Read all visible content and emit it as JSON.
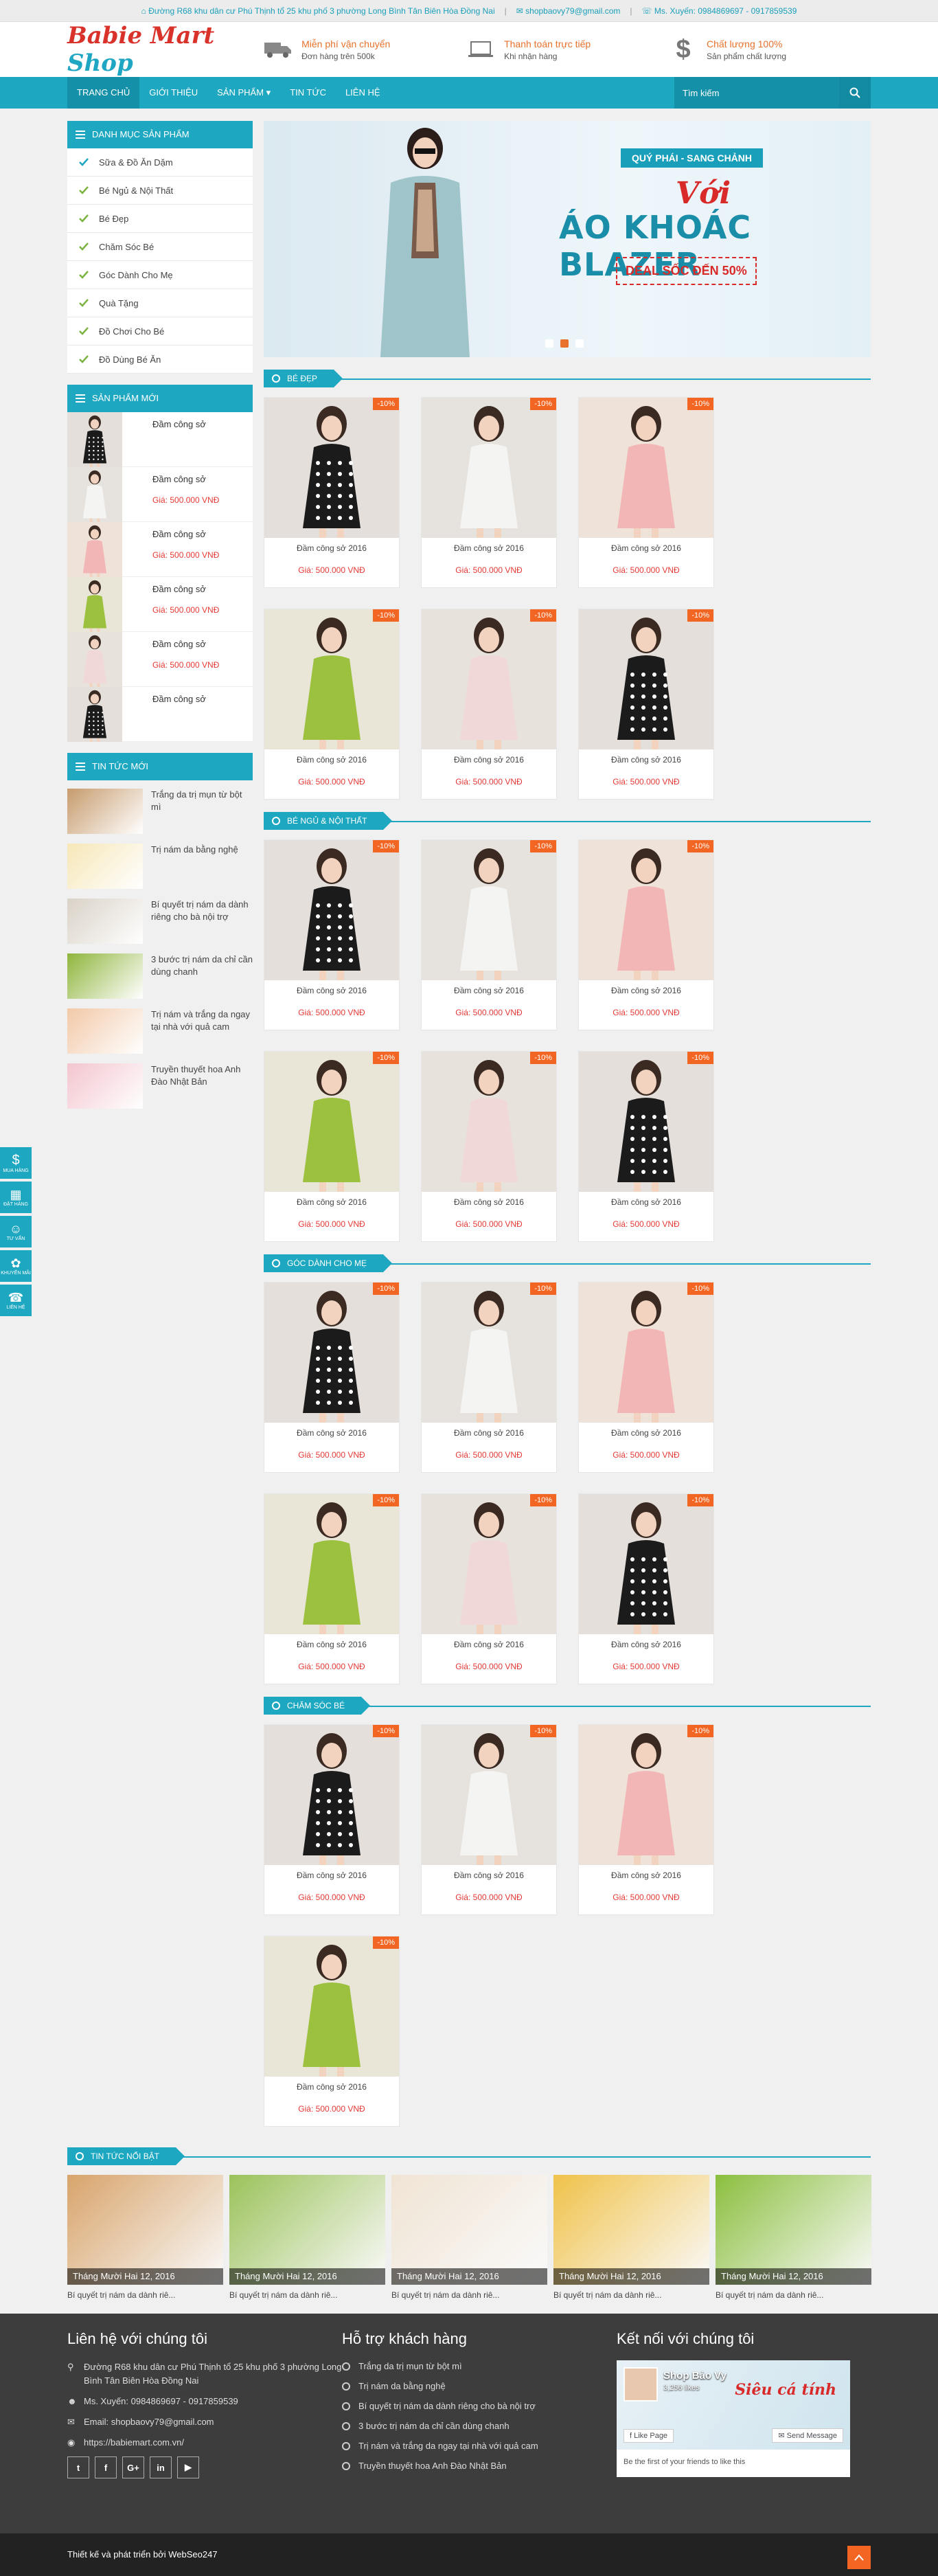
{
  "topbar": {
    "address": "Đường R68 khu dân cư Phú Thịnh tổ 25 khu phố 3 phường Long Bình Tân Biên Hòa Đồng Nai",
    "email": "shopbaovy79@gmail.com",
    "phone": "Ms. Xuyến: 0984869697 - 0917859539"
  },
  "logo": {
    "part1": "Babie Mart",
    "part2": "Shop"
  },
  "features": [
    {
      "title": "Miễn phí vận chuyển",
      "sub": "Đơn hàng trên 500k"
    },
    {
      "title": "Thanh toán trực tiếp",
      "sub": "Khi nhận hàng"
    },
    {
      "title": "Chất lượng 100%",
      "sub": "Sản phẩm chất lượng"
    }
  ],
  "nav": {
    "items": [
      "TRANG CHỦ",
      "GIỚI THIỆU",
      "SẢN PHẨM",
      "TIN TỨC",
      "LIÊN HỆ"
    ],
    "search_placeholder": "Tìm kiếm"
  },
  "sidebar": {
    "categories_title": "DANH MỤC SẢN PHẨM",
    "categories": [
      "Sữa & Đồ Ăn Dặm",
      "Bé Ngủ & Nội Thất",
      "Bé Đẹp",
      "Chăm Sóc Bé",
      "Góc Dành Cho Mẹ",
      "Quà Tặng",
      "Đồ Chơi Cho Bé",
      "Đồ Dùng Bé Ăn"
    ],
    "new_products_title": "SẢN PHẨM MỚI",
    "new_products": [
      {
        "name": "Đầm công sở",
        "price": ""
      },
      {
        "name": "Đầm công sở",
        "price": "Giá: 500.000 VNĐ"
      },
      {
        "name": "Đầm công sở",
        "price": "Giá: 500.000 VNĐ"
      },
      {
        "name": "Đầm công sở",
        "price": "Giá: 500.000 VNĐ"
      },
      {
        "name": "Đầm công sở",
        "price": "Giá: 500.000 VNĐ"
      },
      {
        "name": "Đầm công sở",
        "price": ""
      }
    ],
    "news_title": "TIN TỨC MỚI",
    "news": [
      "Trắng da trị mụn từ bột mì",
      "Trị nám da bằng nghệ",
      "Bí quyết trị nám da dành riêng cho bà nội trợ",
      "3 bước trị nám da chỉ cần dùng chanh",
      "Trị nám và trắng da ngay tại nhà với quả cam",
      "Truyền thuyết hoa Anh Đào Nhật Bản"
    ]
  },
  "banner": {
    "tag": "QUÝ PHÁI - SANG CHẢNH",
    "voi": "Với",
    "headline": "ÁO KHOÁC BLAZER",
    "deal": "DEAL SỐC ĐẾN 50%"
  },
  "sections": [
    {
      "title": "BÉ ĐẸP",
      "products": [
        {
          "name": "Đầm công sở 2016",
          "price": "Giá: 500.000 VNĐ",
          "badge": "-10%"
        },
        {
          "name": "Đầm công sở 2016",
          "price": "Giá: 500.000 VNĐ",
          "badge": "-10%"
        },
        {
          "name": "Đầm công sở 2016",
          "price": "Giá: 500.000 VNĐ",
          "badge": "-10%"
        },
        {
          "name": "Đầm công sở 2016",
          "price": "Giá: 500.000 VNĐ",
          "badge": "-10%"
        },
        {
          "name": "Đầm công sở 2016",
          "price": "Giá: 500.000 VNĐ",
          "badge": "-10%"
        },
        {
          "name": "Đầm công sở 2016",
          "price": "Giá: 500.000 VNĐ",
          "badge": "-10%"
        }
      ]
    },
    {
      "title": "BÉ NGỦ & NỘI THẤT",
      "products": [
        {
          "name": "Đầm công sở 2016",
          "price": "Giá: 500.000 VNĐ",
          "badge": "-10%"
        },
        {
          "name": "Đầm công sở 2016",
          "price": "Giá: 500.000 VNĐ",
          "badge": "-10%"
        },
        {
          "name": "Đầm công sở 2016",
          "price": "Giá: 500.000 VNĐ",
          "badge": "-10%"
        },
        {
          "name": "Đầm công sở 2016",
          "price": "Giá: 500.000 VNĐ",
          "badge": "-10%"
        },
        {
          "name": "Đầm công sở 2016",
          "price": "Giá: 500.000 VNĐ",
          "badge": "-10%"
        },
        {
          "name": "Đầm công sở 2016",
          "price": "Giá: 500.000 VNĐ",
          "badge": "-10%"
        }
      ]
    },
    {
      "title": "GÓC DÀNH CHO MẸ",
      "products": [
        {
          "name": "Đầm công sở 2016",
          "price": "Giá: 500.000 VNĐ",
          "badge": "-10%"
        },
        {
          "name": "Đầm công sở 2016",
          "price": "Giá: 500.000 VNĐ",
          "badge": "-10%"
        },
        {
          "name": "Đầm công sở 2016",
          "price": "Giá: 500.000 VNĐ",
          "badge": "-10%"
        },
        {
          "name": "Đầm công sở 2016",
          "price": "Giá: 500.000 VNĐ",
          "badge": "-10%"
        },
        {
          "name": "Đầm công sở 2016",
          "price": "Giá: 500.000 VNĐ",
          "badge": "-10%"
        },
        {
          "name": "Đầm công sở 2016",
          "price": "Giá: 500.000 VNĐ",
          "badge": "-10%"
        }
      ]
    },
    {
      "title": "CHĂM SÓC BÉ",
      "products": [
        {
          "name": "Đầm công sở 2016",
          "price": "Giá: 500.000 VNĐ",
          "badge": "-10%"
        },
        {
          "name": "Đầm công sở 2016",
          "price": "Giá: 500.000 VNĐ",
          "badge": "-10%"
        },
        {
          "name": "Đầm công sở 2016",
          "price": "Giá: 500.000 VNĐ",
          "badge": "-10%"
        },
        {
          "name": "Đầm công sở 2016",
          "price": "Giá: 500.000 VNĐ",
          "badge": "-10%"
        }
      ]
    }
  ],
  "featured": {
    "title": "TIN TỨC NỔI BẬT",
    "items": [
      {
        "date": "Tháng Mười Hai 12, 2016",
        "title": "Bí quyết trị nám da dành riê..."
      },
      {
        "date": "Tháng Mười Hai 12, 2016",
        "title": "Bí quyết trị nám da dành riê..."
      },
      {
        "date": "Tháng Mười Hai 12, 2016",
        "title": "Bí quyết trị nám da dành riê..."
      },
      {
        "date": "Tháng Mười Hai 12, 2016",
        "title": "Bí quyết trị nám da dành riê..."
      },
      {
        "date": "Tháng Mười Hai 12, 2016",
        "title": "Bí quyết trị nám da dành riê..."
      }
    ]
  },
  "floatbar": [
    "MUA HÀNG",
    "ĐẶT HÀNG",
    "TƯ VẤN",
    "KHUYẾN MÃI",
    "LIÊN HỆ"
  ],
  "footer": {
    "contact_title": "Liên hệ với chúng tôi",
    "address": "Đường R68 khu dân cư Phú Thịnh tổ 25 khu phố 3 phường Long Bình Tân Biên Hòa Đồng Nai",
    "phone": "Ms. Xuyến: 0984869697 - 0917859539",
    "email": "Email: shopbaovy79@gmail.com",
    "website": "https://babiemart.com.vn/",
    "socials": [
      "t",
      "f",
      "G+",
      "in",
      "▶"
    ],
    "support_title": "Hỗ trợ khách hàng",
    "support_links": [
      "Trắng da trị mụn từ bột mì",
      "Trị nám da bằng nghệ",
      "Bí quyết trị nám da dành riêng cho bà nội trợ",
      "3 bước trị nám da chỉ cần dùng chanh",
      "Trị nám và trắng da ngay tại nhà với quả cam",
      "Truyền thuyết hoa Anh Đào Nhật Bản"
    ],
    "connect_title": "Kết nối với chúng tôi",
    "fb": {
      "name": "Shop Bảo Vy",
      "likes": "3,256 likes",
      "cover_title": "Siêu cá tính",
      "like_label": "Like Page",
      "message_label": "Send Message",
      "foot": "Be the first of your friends to like this"
    }
  },
  "copyright": "Thiết kế và phát triển bởi WebSeo247",
  "colors": {
    "primary": "#1ea7c0",
    "accent": "#f26522",
    "price": "#e53935",
    "logo_red": "#d9322b"
  }
}
